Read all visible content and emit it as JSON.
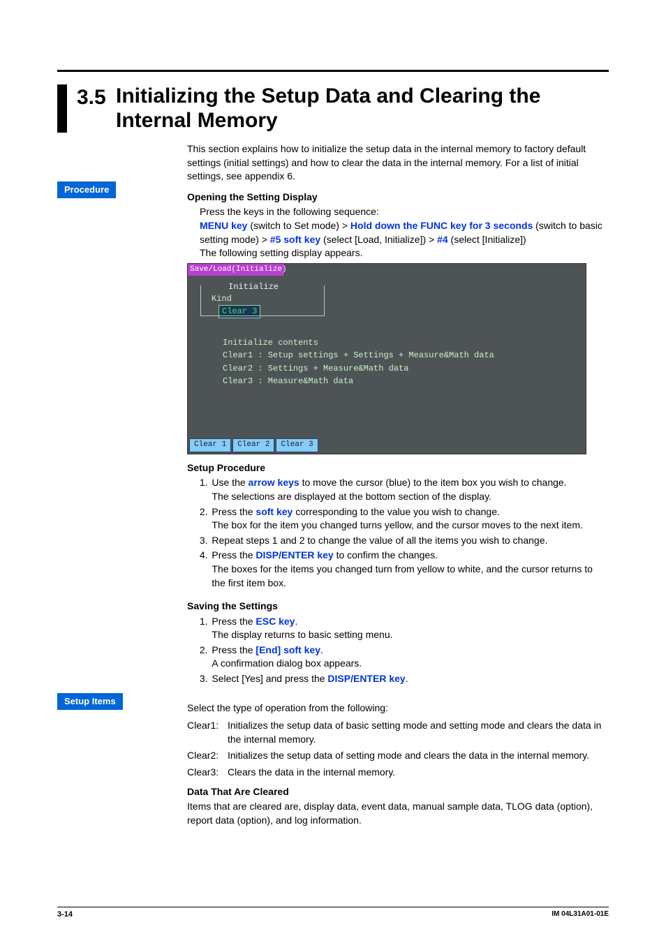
{
  "section": {
    "number": "3.5",
    "title": "Initializing the Setup Data and Clearing the Internal Memory"
  },
  "intro": "This section explains how to initialize the setup data in the internal memory to factory default settings (initial settings) and how to clear the data in the internal memory.  For a list of initial settings, see appendix 6.",
  "labels": {
    "procedure": "Procedure",
    "setup_items": "Setup Items"
  },
  "opening": {
    "heading": "Opening the Setting Display",
    "line1": "Press the keys in the following sequence:",
    "seq": {
      "p1": "MENU key",
      "p1_after": " (switch to Set mode) > ",
      "p2": "Hold down the FUNC key for 3 seconds",
      "p2_after": " (switch to basic setting mode) > ",
      "p3": "#5 soft key",
      "p3_after": " (select [Load, Initialize]) > ",
      "p4": "#4",
      "p4_after": " (select [Initialize])"
    },
    "line3": "The following setting display appears."
  },
  "screenshot": {
    "titlebar": "Save/Load(Initialize)",
    "group_label": "Initialize",
    "kind_label": "Kind",
    "kind_value": "Clear 3",
    "contents_title": "Initialize contents",
    "row1": "Clear1 : Setup settings + Settings + Measure&Math data",
    "row2": "Clear2 : Settings + Measure&Math data",
    "row3": "Clear3 : Measure&Math data",
    "btn1": "Clear 1",
    "btn2": "Clear 2",
    "btn3": "Clear 3"
  },
  "setup_proc": {
    "heading": "Setup Procedure",
    "s1a": "Use the ",
    "s1_hl": "arrow keys",
    "s1b": " to move the cursor (blue) to the item box you wish to change.",
    "s1c": "The selections are displayed at the bottom section of the display.",
    "s2a": "Press the ",
    "s2_hl": "soft key",
    "s2b": " corresponding to the value you wish to change.",
    "s2c": "The box for the item you changed turns yellow, and the cursor moves to the next item.",
    "s3": "Repeat steps 1 and 2 to change the value of all the items you wish to change.",
    "s4a": "Press the ",
    "s4_hl": "DISP/ENTER key",
    "s4b": " to confirm the changes.",
    "s4c": "The boxes for the items you changed turn from yellow to white, and the cursor returns to the first item box."
  },
  "saving": {
    "heading": "Saving the Settings",
    "s1a": "Press the ",
    "s1_hl": "ESC key",
    "s1b": ".",
    "s1c": "The display returns to basic setting menu.",
    "s2a": "Press the ",
    "s2_hl": "[End] soft key",
    "s2b": ".",
    "s2c": "A confirmation dialog box appears.",
    "s3a": "Select [Yes] and press the ",
    "s3_hl": "DISP/ENTER key",
    "s3b": "."
  },
  "setup_items": {
    "intro": "Select the type of operation from the following:",
    "c1_t": "Clear1:",
    "c1": "Initializes the setup data of basic setting mode and setting mode and clears the data in the internal memory.",
    "c2_t": "Clear2:",
    "c2": "Initializes the setup data of setting mode and clears the data in the internal memory.",
    "c3_t": "Clear3:",
    "c3": "Clears the data in the internal memory.",
    "data_heading": "Data That Are Cleared",
    "data_body": "Items that are cleared are, display data, event data, manual sample data, TLOG data (option), report data (option), and log information."
  },
  "footer": {
    "page": "3-14",
    "doc": "IM 04L31A01-01E"
  }
}
